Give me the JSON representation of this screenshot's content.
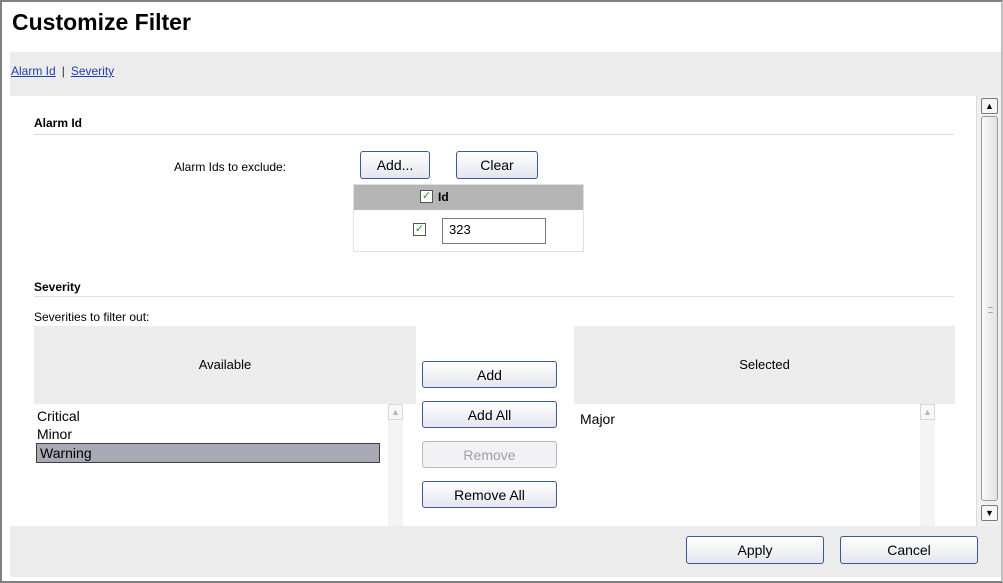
{
  "title": "Customize Filter",
  "nav": {
    "links": [
      "Alarm Id",
      "Severity"
    ],
    "separator": "|"
  },
  "alarm_section": {
    "title": "Alarm Id",
    "exclude_label": "Alarm Ids to exclude:",
    "add_button": "Add...",
    "clear_button": "Clear",
    "table": {
      "header": "Id",
      "header_checked": true,
      "rows": [
        {
          "checked": true,
          "value": "323"
        }
      ]
    }
  },
  "severity_section": {
    "title": "Severity",
    "filter_label": "Severities to filter out:",
    "available_header": "Available",
    "selected_header": "Selected",
    "available_items": [
      "Critical",
      "Minor",
      "Warning"
    ],
    "available_selected": "Warning",
    "selected_items": [
      "Major"
    ],
    "buttons": {
      "add": "Add",
      "add_all": "Add All",
      "remove": "Remove",
      "remove_all": "Remove All"
    }
  },
  "footer": {
    "apply": "Apply",
    "cancel": "Cancel"
  },
  "icons": {
    "check": "checkmark-icon",
    "scroll_up": "scroll-up-arrow-icon",
    "scroll_down": "scroll-down-arrow-icon"
  },
  "colors": {
    "link": "#1f3fae",
    "panel_bg": "#ececec",
    "table_header": "#b5b5b5",
    "selection": "#a9a9b5",
    "button_border": "#3a5a94"
  }
}
